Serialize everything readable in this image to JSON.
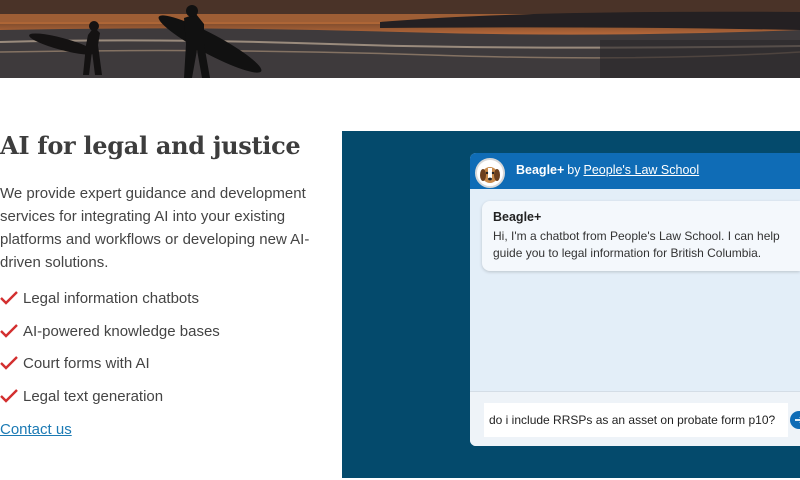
{
  "hero": {
    "icon": "surfers-at-sunset-photo"
  },
  "section": {
    "title": "AI for legal and justice",
    "intro": "We provide expert guidance and development services for integrating AI into your existing platforms and workflows or developing new AI-driven solutions.",
    "features": [
      "Legal information chatbots",
      "AI-powered knowledge bases",
      "Court forms with AI",
      "Legal text generation"
    ],
    "check_color": "#d32f2f",
    "contact_link": "Contact us"
  },
  "chat": {
    "bot_name": "Beagle+",
    "by": "by",
    "organization": "People's Law School",
    "messages": [
      {
        "sender": "Beagle+",
        "text": "Hi, I'm a chatbot from People's Law School. I can help guide you to legal information for British Columbia."
      }
    ],
    "input_value": "do i include RRSPs as an asset on probate form p10?",
    "header_color": "#0f6cb6",
    "panel_color": "#044a6c"
  }
}
